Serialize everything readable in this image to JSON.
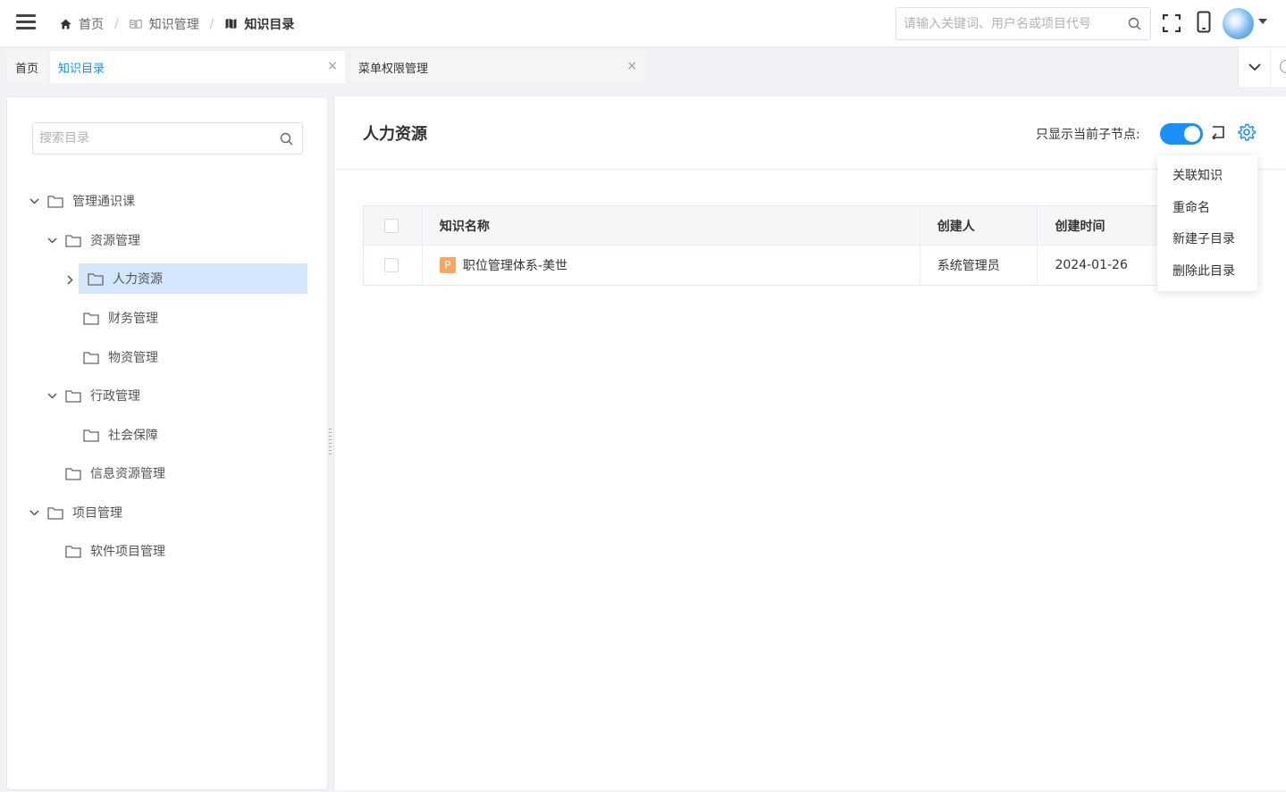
{
  "header": {
    "breadcrumb": [
      {
        "label": "首页"
      },
      {
        "label": "知识管理"
      },
      {
        "label": "知识目录"
      }
    ],
    "search_placeholder": "请输入关键词、用户名或项目代号"
  },
  "tabs": [
    {
      "label": "首页"
    },
    {
      "label": "知识目录"
    },
    {
      "label": "菜单权限管理"
    }
  ],
  "tree": {
    "search_placeholder": "搜索目录",
    "nodes": [
      {
        "label": "管理通识课"
      },
      {
        "label": "资源管理"
      },
      {
        "label": "人力资源"
      },
      {
        "label": "财务管理"
      },
      {
        "label": "物资管理"
      },
      {
        "label": "行政管理"
      },
      {
        "label": "社会保障"
      },
      {
        "label": "信息资源管理"
      },
      {
        "label": "项目管理"
      },
      {
        "label": "软件项目管理"
      }
    ]
  },
  "main": {
    "title": "人力资源",
    "toggle_label": "只显示当前子节点:",
    "toggle_on": true,
    "menu": [
      {
        "label": "关联知识"
      },
      {
        "label": "重命名"
      },
      {
        "label": "新建子目录"
      },
      {
        "label": "删除此目录"
      }
    ],
    "table": {
      "columns": [
        "知识名称",
        "创建人",
        "创建时间"
      ],
      "rows": [
        {
          "type_badge": "P",
          "name": "职位管理体系-美世",
          "creator": "系统管理员",
          "time": "2024-01-26"
        }
      ]
    }
  },
  "colors": {
    "accent": "#1890ff",
    "selected_bg": "#d4e6fb",
    "badge": "#f6a661"
  }
}
